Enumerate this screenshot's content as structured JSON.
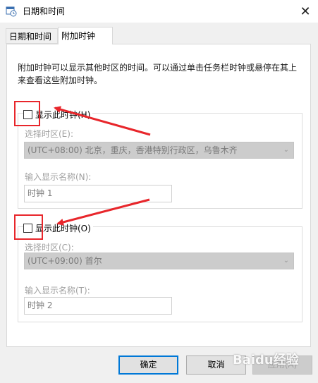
{
  "window": {
    "title": "日期和时间",
    "close_glyph": "✕"
  },
  "tabs": [
    {
      "label": "日期和时间",
      "selected": false
    },
    {
      "label": "附加时钟",
      "selected": true
    }
  ],
  "panel": {
    "description": "附加时钟可以显示其他时区的时间。可以通过单击任务栏时钟或悬停在其上来查看这些附加时钟。"
  },
  "clock1": {
    "checkbox_label": "显示此时钟(H)",
    "checked": false,
    "timezone_label": "选择时区(E):",
    "timezone_value": "(UTC+08:00) 北京，重庆，香港特别行政区，乌鲁木齐",
    "name_label": "输入显示名称(N):",
    "name_value": "时钟 1"
  },
  "clock2": {
    "checkbox_label": "显示此时钟(O)",
    "checked": false,
    "timezone_label": "选择时区(C):",
    "timezone_value": "(UTC+09:00) 首尔",
    "name_label": "输入显示名称(T):",
    "name_value": "时钟 2"
  },
  "buttons": {
    "ok": "确定",
    "cancel": "取消",
    "apply": "应用(A)"
  },
  "watermark": "Baidu经验",
  "colors": {
    "annotation_red": "#e8262b",
    "accent_blue": "#0078d7",
    "disabled_gray": "#a0a0a0"
  },
  "icons": {
    "app": "calendar-clock-icon",
    "close": "close-icon",
    "dropdown": "chevron-down-icon"
  }
}
